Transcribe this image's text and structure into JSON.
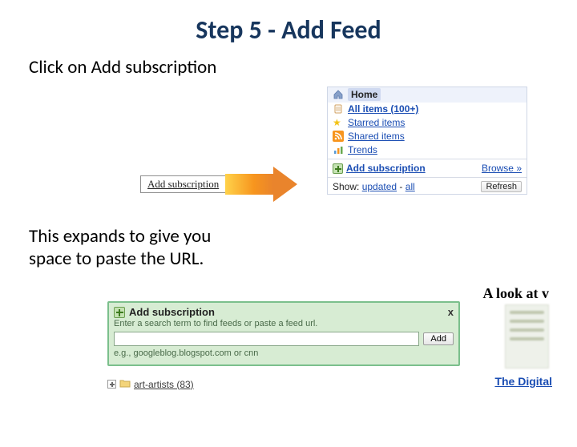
{
  "title": "Step 5 - Add Feed",
  "instruction1": "Click on Add subscription",
  "instruction2_l1": "This expands to give you",
  "instruction2_l2": "space to paste the URL.",
  "arrow_label": "Add subscription",
  "reader": {
    "home": "Home",
    "all_items": "All items (100+)",
    "starred": "Starred items",
    "shared": "Shared items",
    "trends": "Trends",
    "add_subscription": "Add subscription",
    "browse": "Browse »",
    "show_label": "Show:",
    "show_updated": "updated",
    "show_sep": " - ",
    "show_all": "all",
    "refresh": "Refresh"
  },
  "expanded": {
    "peek_title": "A look at v",
    "head": "Add subscription",
    "close": "x",
    "hint": "Enter a search term to find feeds or paste a feed url.",
    "add_btn": "Add",
    "example": "e.g., googleblog.blogspot.com or cnn",
    "folder": "art-artists (83)",
    "peek_link": "The Digital"
  }
}
